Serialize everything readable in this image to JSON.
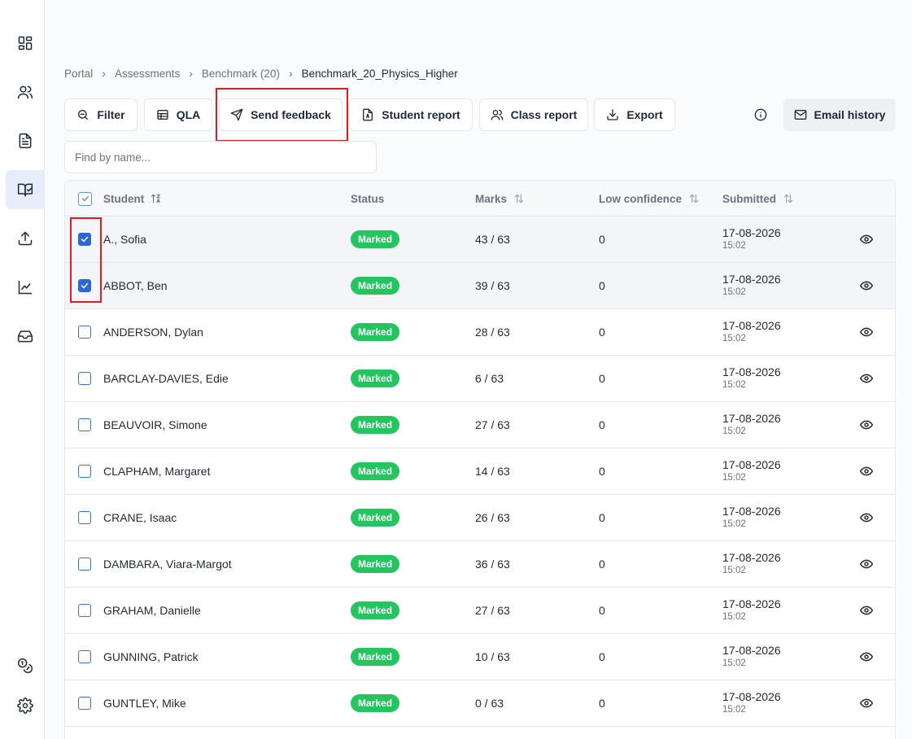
{
  "breadcrumb": {
    "items": [
      "Portal",
      "Assessments",
      "Benchmark (20)"
    ],
    "current": "Benchmark_20_Physics_Higher"
  },
  "toolbar": {
    "filter": "Filter",
    "qla": "QLA",
    "send_feedback": "Send feedback",
    "student_report": "Student report",
    "class_report": "Class report",
    "export": "Export",
    "email_history": "Email history"
  },
  "search": {
    "placeholder": "Find by name..."
  },
  "table": {
    "headers": {
      "student": "Student",
      "status": "Status",
      "marks": "Marks",
      "low_confidence": "Low confidence",
      "submitted": "Submitted"
    },
    "rows": [
      {
        "name": "A., Sofia",
        "status": "Marked",
        "marks": "43 / 63",
        "low": "0",
        "date": "17-08-2026",
        "time": "15:02",
        "checked": true
      },
      {
        "name": "ABBOT, Ben",
        "status": "Marked",
        "marks": "39 / 63",
        "low": "0",
        "date": "17-08-2026",
        "time": "15:02",
        "checked": true
      },
      {
        "name": "ANDERSON, Dylan",
        "status": "Marked",
        "marks": "28 / 63",
        "low": "0",
        "date": "17-08-2026",
        "time": "15:02",
        "checked": false
      },
      {
        "name": "BARCLAY-DAVIES, Edie",
        "status": "Marked",
        "marks": "6 / 63",
        "low": "0",
        "date": "17-08-2026",
        "time": "15:02",
        "checked": false
      },
      {
        "name": "BEAUVOIR, Simone",
        "status": "Marked",
        "marks": "27 / 63",
        "low": "0",
        "date": "17-08-2026",
        "time": "15:02",
        "checked": false
      },
      {
        "name": "CLAPHAM, Margaret",
        "status": "Marked",
        "marks": "14 / 63",
        "low": "0",
        "date": "17-08-2026",
        "time": "15:02",
        "checked": false
      },
      {
        "name": "CRANE, Isaac",
        "status": "Marked",
        "marks": "26 / 63",
        "low": "0",
        "date": "17-08-2026",
        "time": "15:02",
        "checked": false
      },
      {
        "name": "DAMBARA, Viara-Margot",
        "status": "Marked",
        "marks": "36 / 63",
        "low": "0",
        "date": "17-08-2026",
        "time": "15:02",
        "checked": false
      },
      {
        "name": "GRAHAM, Danielle",
        "status": "Marked",
        "marks": "27 / 63",
        "low": "0",
        "date": "17-08-2026",
        "time": "15:02",
        "checked": false
      },
      {
        "name": "GUNNING, Patrick",
        "status": "Marked",
        "marks": "10 / 63",
        "low": "0",
        "date": "17-08-2026",
        "time": "15:02",
        "checked": false
      },
      {
        "name": "GUNTLEY, Mike",
        "status": "Marked",
        "marks": "0 / 63",
        "low": "0",
        "date": "17-08-2026",
        "time": "15:02",
        "checked": false
      }
    ]
  },
  "sidebar": {
    "icons": [
      "dashboard-icon",
      "users-icon",
      "document-icon",
      "assessment-icon",
      "upload-icon",
      "chart-icon",
      "inbox-icon",
      "coins-icon",
      "settings-icon"
    ],
    "active": "assessment-icon"
  },
  "colors": {
    "accent": "#2e66d6",
    "badge": "#22c55e",
    "highlight": "#e11d23",
    "active_nav": "#e7eefb"
  }
}
